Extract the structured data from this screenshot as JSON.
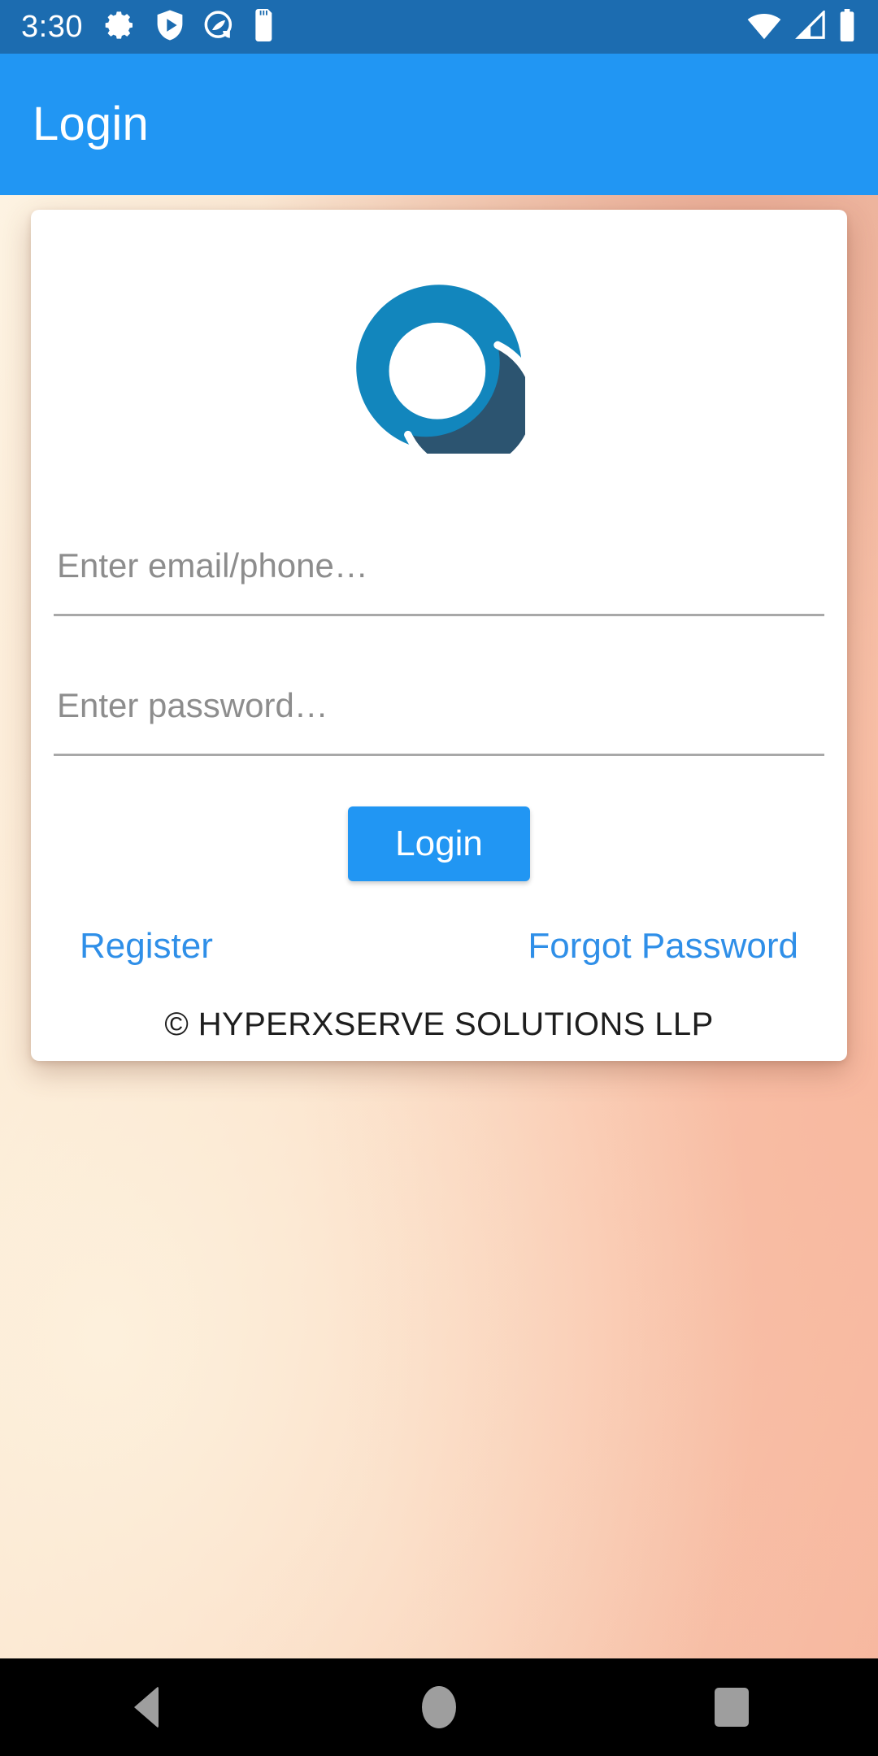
{
  "status_bar": {
    "clock": "3:30",
    "background_color": "#1c6cb0",
    "left_icons": [
      {
        "name": "settings-gear-icon",
        "label": "Settings"
      },
      {
        "name": "play-protect-shield-icon",
        "label": "Play Protect"
      },
      {
        "name": "circular-app-icon",
        "label": "App notification"
      },
      {
        "name": "sd-card-icon",
        "label": "SD card"
      }
    ],
    "right_icons": [
      {
        "name": "wifi-icon",
        "label": "Wi-Fi"
      },
      {
        "name": "cellular-signal-icon",
        "label": "Mobile signal"
      },
      {
        "name": "battery-full-icon",
        "label": "Battery"
      }
    ]
  },
  "app_bar": {
    "title": "Login",
    "background_color": "#2196f3",
    "title_color": "#ffffff"
  },
  "card": {
    "logo": {
      "name": "hyperxserve-logo",
      "outer_circle_color": "#1286bd",
      "crescent_color": "#2c5470",
      "inner_color": "#ffffff"
    },
    "email_field": {
      "placeholder": "Enter email/phone…",
      "value": ""
    },
    "password_field": {
      "placeholder": "Enter password…",
      "value": ""
    },
    "login_button": {
      "label": "Login",
      "background_color": "#2196f3",
      "text_color": "#ffffff"
    },
    "register_link": {
      "label": "Register",
      "color": "#2f8fe8"
    },
    "forgot_password_link": {
      "label": "Forgot Password",
      "color": "#2f8fe8"
    },
    "copyright": "© HYPERXSERVE SOLUTIONS LLP"
  },
  "nav_bar": {
    "background_color": "#000000",
    "icon_color": "#9e9e9e",
    "buttons": [
      {
        "name": "nav-back-button",
        "label": "Back"
      },
      {
        "name": "nav-home-button",
        "label": "Home"
      },
      {
        "name": "nav-recents-button",
        "label": "Recents"
      }
    ]
  }
}
